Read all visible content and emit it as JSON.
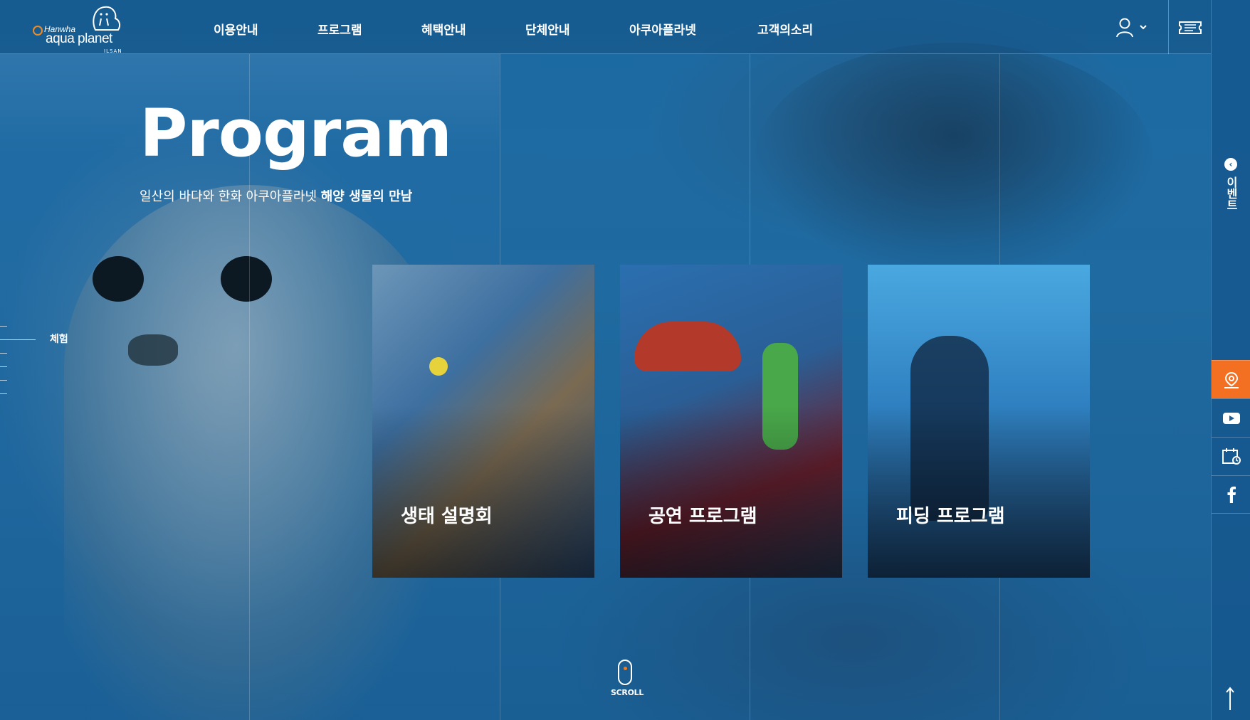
{
  "header": {
    "logo": {
      "brand": "Hanwha",
      "name": "aqua planet",
      "sub": "ILSAN"
    },
    "nav": [
      {
        "label": "이용안내"
      },
      {
        "label": "프로그램"
      },
      {
        "label": "혜택안내"
      },
      {
        "label": "단체안내"
      },
      {
        "label": "아쿠아플라넷"
      },
      {
        "label": "고객의소리"
      }
    ],
    "user_icon": "user-icon",
    "ticket_icon": "ticket-icon"
  },
  "hero": {
    "title": "Program",
    "subtitle_normal": "일산의 바다와 한화 아쿠아플라넷 ",
    "subtitle_bold": "해양 생물의 만남"
  },
  "side_nav": {
    "active_label": "체험"
  },
  "cards": [
    {
      "label": "생태 설명회"
    },
    {
      "label": "공연 프로그램"
    },
    {
      "label": "피딩 프로그램"
    }
  ],
  "scroll": {
    "label": "SCROLL"
  },
  "right_sidebar": {
    "event_label": "이벤트",
    "buttons": [
      {
        "icon": "location-icon",
        "active": true
      },
      {
        "icon": "youtube-icon",
        "active": false
      },
      {
        "icon": "calendar-icon",
        "active": false
      },
      {
        "icon": "facebook-icon",
        "active": false
      }
    ]
  },
  "colors": {
    "accent": "#f36f21",
    "background": "#1e5f92"
  }
}
